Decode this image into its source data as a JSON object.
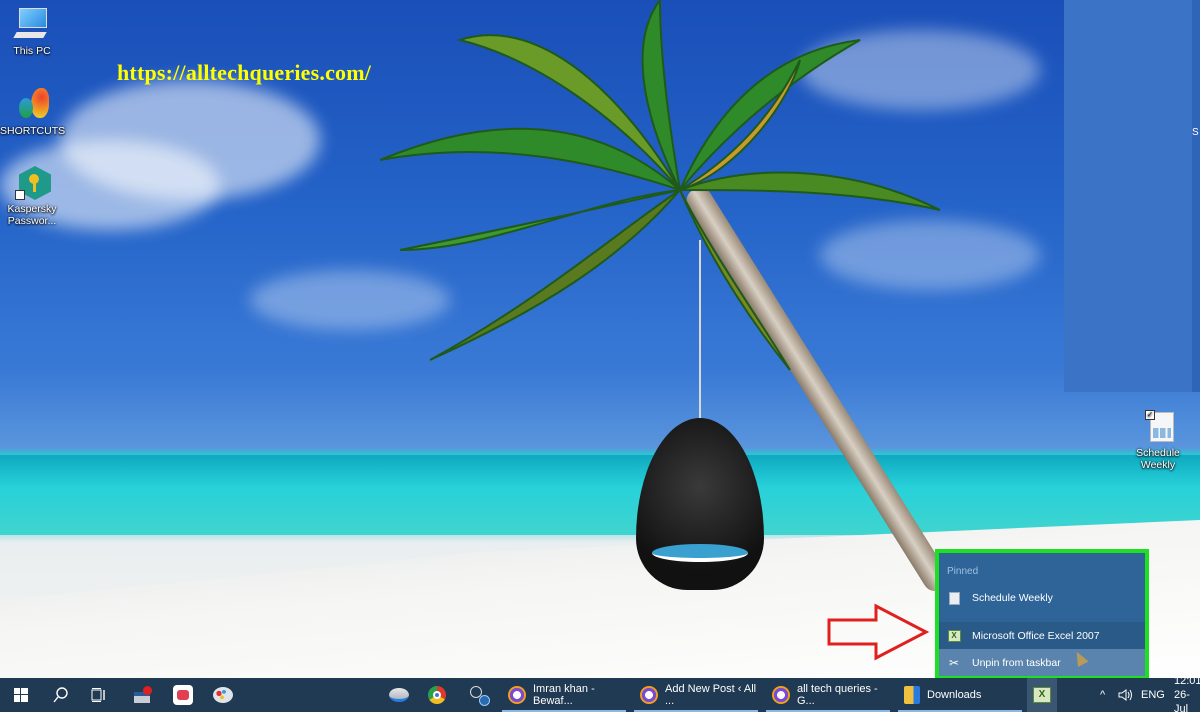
{
  "watermark": {
    "text": "https://alltechqueries.com/"
  },
  "desktop_icons": [
    {
      "label": "This PC",
      "icon": "computer-icon"
    },
    {
      "label": "SHORTCUTS",
      "icon": "butterfly-icon"
    },
    {
      "label_line1": "Kaspersky",
      "label_line2": "Passwor...",
      "icon": "kaspersky-key-icon"
    },
    {
      "label_line1": "Schedule",
      "label_line2": "Weekly",
      "icon": "excel-file-icon"
    }
  ],
  "snap_panel": {
    "partial_text": "S"
  },
  "jump_list": {
    "section_label": "Pinned",
    "pinned_items": [
      {
        "label": "Schedule Weekly",
        "icon": "excel-doc-icon"
      }
    ],
    "app_item": {
      "label": "Microsoft Office Excel 2007",
      "icon": "excel-icon"
    },
    "action_item": {
      "label": "Unpin from taskbar",
      "icon": "unpin-icon"
    },
    "highlight_color": "#1ee023"
  },
  "annotation": {
    "arrow_color": "#e0201e",
    "arrow_direction": "right"
  },
  "taskbar": {
    "pinned_icons": [
      "windows-start-icon",
      "search-icon",
      "task-view-icon",
      "app-icon-1",
      "app-icon-2",
      "paint-icon",
      "app-icon-3",
      "chrome-icon",
      "tool-icon"
    ],
    "apps": [
      {
        "label": "Imran khan - Bewaf...",
        "icon": "browser-shield-icon"
      },
      {
        "label": "Add New Post ‹ All ...",
        "icon": "browser-shield-icon"
      },
      {
        "label": "all tech queries - G...",
        "icon": "browser-shield-icon"
      },
      {
        "label": "Downloads",
        "icon": "folder-icon"
      }
    ],
    "active_app_icon": "excel-icon",
    "tray": {
      "chevron": "^",
      "volume_icon": "volume-icon",
      "language": "ENG",
      "time": "12:01",
      "date": "26-Jul"
    }
  }
}
